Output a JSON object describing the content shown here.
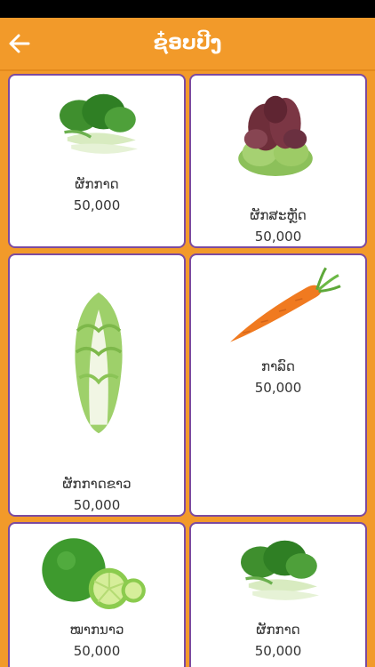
{
  "header": {
    "title": "ຊ໋ອບປີງ",
    "back_icon": "arrow-left-icon"
  },
  "theme": {
    "accent": "#F29A2A",
    "card_border": "#7B4AA0",
    "text": "#333333"
  },
  "products": [
    {
      "name": "ຜັກກາດ",
      "price": "50,000",
      "image": "bok-choy"
    },
    {
      "name": "ຜັກສະຫຼັດ",
      "price": "50,000",
      "image": "red-lettuce"
    },
    {
      "name": "ຜັກກາດຂາວ",
      "price": "50,000",
      "image": "napa-cabbage"
    },
    {
      "name": "ກາລົດ",
      "price": "50,000",
      "image": "carrot"
    },
    {
      "name": "ໝາກນາວ",
      "price": "50,000",
      "image": "lime"
    },
    {
      "name": "ຜັກກາດ",
      "price": "50,000",
      "image": "bok-choy"
    }
  ]
}
